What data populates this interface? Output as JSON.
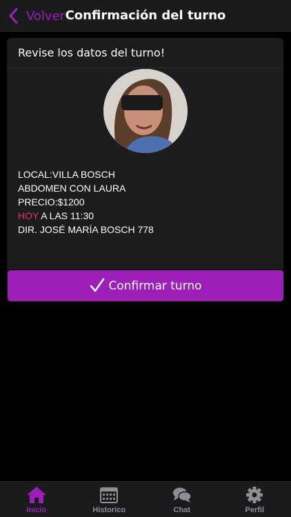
{
  "colors": {
    "accent": "#9b1fb8",
    "highlight": "#e0356f",
    "tab_inactive": "#8e8e93"
  },
  "navbar": {
    "back_label": "Volver",
    "title": "Confirmación del turno"
  },
  "card": {
    "header": "Revise los datos del turno!",
    "details": {
      "local": "LOCAL:VILLA BOSCH",
      "service": "ABDOMEN CON LAURA",
      "price": "PRECIO:$1200",
      "day": "HOY",
      "time": " A LAS 11:30",
      "address": "DIR. JOSÉ MARÍA BOSCH 778"
    }
  },
  "confirm_button": {
    "label": "Confirmar turno"
  },
  "tabbar": {
    "tabs": [
      {
        "label": "Inicio",
        "icon": "home-icon",
        "active": true
      },
      {
        "label": "Historico",
        "icon": "calendar-icon",
        "active": false
      },
      {
        "label": "Chat",
        "icon": "chat-icon",
        "active": false
      },
      {
        "label": "Perfil",
        "icon": "gear-icon",
        "active": false
      }
    ]
  }
}
